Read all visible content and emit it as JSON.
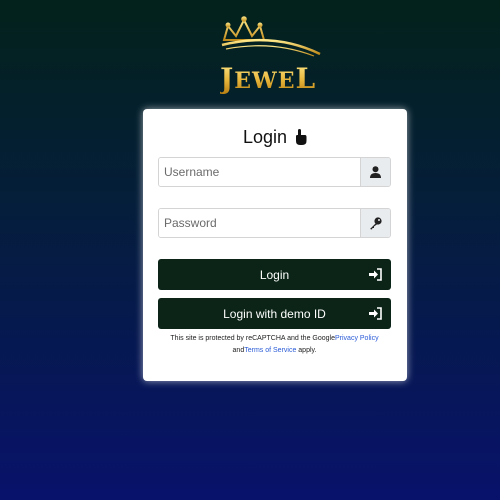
{
  "brand": {
    "name_J": "J",
    "name_ewe": "EWE",
    "name_L": "L"
  },
  "login": {
    "title": "Login",
    "username_placeholder": "Username",
    "password_placeholder": "Password",
    "login_button": "Login",
    "demo_button": "Login with demo ID"
  },
  "recaptcha": {
    "text_before": "This site is protected by reCAPTCHA and the Google",
    "privacy_link": "Privacy Policy",
    "text_and": " and",
    "terms_link": "Terms of Service",
    "text_after": " apply."
  },
  "icons": {
    "title": "hand-pointer-icon",
    "username": "user-icon",
    "password": "key-icon",
    "login": "sign-in-icon",
    "demo": "sign-in-icon"
  },
  "colors": {
    "button": "#0b2417",
    "gold": "#e7b53a",
    "link": "#2a5bd7"
  }
}
